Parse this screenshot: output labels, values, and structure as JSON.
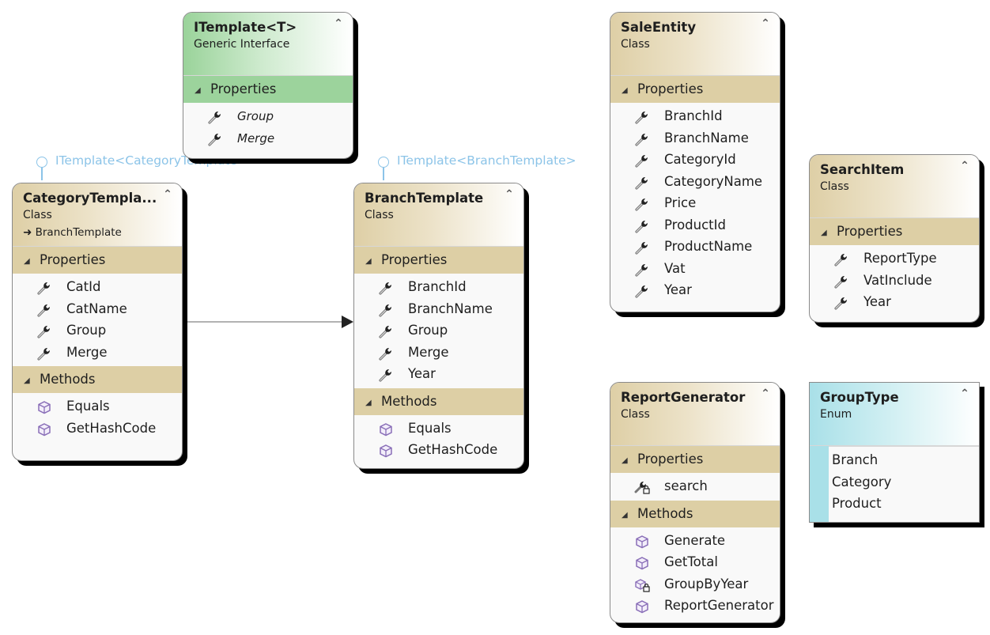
{
  "colors": {
    "class_header": "#decfa6",
    "interface_header": "#9ad39a",
    "enum_header": "#a9e0e8",
    "lollipop": "#8cc4e8",
    "member_icon_method": "#8a6fb8"
  },
  "shapes": {
    "itemplate": {
      "name": "ITemplate<T>",
      "kind": "Generic Interface",
      "sections": [
        {
          "label": "Properties",
          "members": [
            {
              "name": "Group",
              "icon": "wrench-icon"
            },
            {
              "name": "Merge",
              "icon": "wrench-icon"
            }
          ]
        }
      ]
    },
    "category_template": {
      "name": "CategoryTempla...",
      "kind": "Class",
      "base": "BranchTemplate",
      "lollipop": "ITemplate<CategoryTemplate>",
      "sections": [
        {
          "label": "Properties",
          "members": [
            {
              "name": "CatId",
              "icon": "wrench-icon"
            },
            {
              "name": "CatName",
              "icon": "wrench-icon"
            },
            {
              "name": "Group",
              "icon": "wrench-icon"
            },
            {
              "name": "Merge",
              "icon": "wrench-icon"
            }
          ]
        },
        {
          "label": "Methods",
          "members": [
            {
              "name": "Equals",
              "icon": "method-cube-icon"
            },
            {
              "name": "GetHashCode",
              "icon": "method-cube-icon"
            }
          ]
        }
      ]
    },
    "branch_template": {
      "name": "BranchTemplate",
      "kind": "Class",
      "lollipop": "ITemplate<BranchTemplate>",
      "sections": [
        {
          "label": "Properties",
          "members": [
            {
              "name": "BranchId",
              "icon": "wrench-icon"
            },
            {
              "name": "BranchName",
              "icon": "wrench-icon"
            },
            {
              "name": "Group",
              "icon": "wrench-icon"
            },
            {
              "name": "Merge",
              "icon": "wrench-icon"
            },
            {
              "name": "Year",
              "icon": "wrench-icon"
            }
          ]
        },
        {
          "label": "Methods",
          "members": [
            {
              "name": "Equals",
              "icon": "method-cube-icon"
            },
            {
              "name": "GetHashCode",
              "icon": "method-cube-icon"
            }
          ]
        }
      ]
    },
    "sale_entity": {
      "name": "SaleEntity",
      "kind": "Class",
      "sections": [
        {
          "label": "Properties",
          "members": [
            {
              "name": "BranchId",
              "icon": "wrench-icon"
            },
            {
              "name": "BranchName",
              "icon": "wrench-icon"
            },
            {
              "name": "CategoryId",
              "icon": "wrench-icon"
            },
            {
              "name": "CategoryName",
              "icon": "wrench-icon"
            },
            {
              "name": "Price",
              "icon": "wrench-icon"
            },
            {
              "name": "ProductId",
              "icon": "wrench-icon"
            },
            {
              "name": "ProductName",
              "icon": "wrench-icon"
            },
            {
              "name": "Vat",
              "icon": "wrench-icon"
            },
            {
              "name": "Year",
              "icon": "wrench-icon"
            }
          ]
        }
      ]
    },
    "search_item": {
      "name": "SearchItem",
      "kind": "Class",
      "sections": [
        {
          "label": "Properties",
          "members": [
            {
              "name": "ReportType",
              "icon": "wrench-icon"
            },
            {
              "name": "VatInclude",
              "icon": "wrench-icon"
            },
            {
              "name": "Year",
              "icon": "wrench-icon"
            }
          ]
        }
      ]
    },
    "report_generator": {
      "name": "ReportGenerator",
      "kind": "Class",
      "sections": [
        {
          "label": "Properties",
          "members": [
            {
              "name": "search",
              "icon": "private-wrench-icon"
            }
          ]
        },
        {
          "label": "Methods",
          "members": [
            {
              "name": "Generate",
              "icon": "method-cube-icon"
            },
            {
              "name": "GetTotal",
              "icon": "method-cube-icon"
            },
            {
              "name": "GroupByYear",
              "icon": "private-method-cube-icon"
            },
            {
              "name": "ReportGenerator",
              "icon": "method-cube-icon"
            }
          ]
        }
      ]
    },
    "group_type": {
      "name": "GroupType",
      "kind": "Enum",
      "values": [
        "Branch",
        "Category",
        "Product"
      ]
    }
  },
  "connectors": [
    {
      "from": "CategoryTemplate",
      "to": "BranchTemplate",
      "type": "association"
    }
  ]
}
